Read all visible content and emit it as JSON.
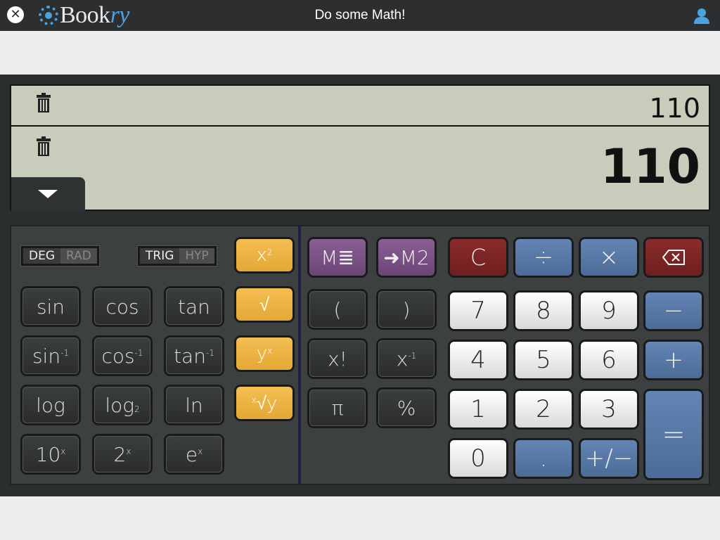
{
  "topbar": {
    "close_icon": "close-icon",
    "logo_text_main": "Book",
    "logo_text_accent": "ry",
    "title": "Do some Math!",
    "user_icon": "user-icon"
  },
  "display": {
    "history_value": "110",
    "main_value": "110",
    "expand_icon": "chevron-down-icon"
  },
  "modes": {
    "angle": {
      "on": "DEG",
      "off": "RAD"
    },
    "func": {
      "on": "TRIG",
      "off": "HYP"
    }
  },
  "scientific": {
    "sin": "sin",
    "cos": "cos",
    "tan": "tan",
    "asin_base": "sin",
    "acos_base": "cos",
    "atan_base": "tan",
    "inv_sup": "-1",
    "log": "log",
    "log2_base": "log",
    "log2_sub": "2",
    "ln": "ln",
    "pow10_base": "10",
    "pow2_base": "2",
    "exp_base": "e",
    "x_sup": "x",
    "square_base": "x",
    "square_sup": "2",
    "sqrt": "√",
    "power_base": "y",
    "power_sup": "x",
    "root_sup": "x",
    "root_base": "√y"
  },
  "memory": {
    "mem_list": "M≣",
    "store_m2": "➜M2"
  },
  "middle": {
    "open_paren": "(",
    "close_paren": ")",
    "factorial": "x!",
    "recip_base": "x",
    "recip_sup": "-1",
    "pi": "π",
    "percent": "%"
  },
  "keypad": {
    "clear": "C",
    "divide": "÷",
    "multiply": "×",
    "backspace_icon": "backspace-icon",
    "seven": "7",
    "eight": "8",
    "nine": "9",
    "minus": "−",
    "four": "4",
    "five": "5",
    "six": "6",
    "plus": "+",
    "one": "1",
    "two": "2",
    "three": "3",
    "equals": "=",
    "zero": "0",
    "dot": ".",
    "negate": "+/−"
  },
  "colors": {
    "gold": "#e9b03d",
    "purple": "#7a5285",
    "red": "#7a2424",
    "blue": "#5677a6",
    "display_bg": "#c8cdbb"
  }
}
